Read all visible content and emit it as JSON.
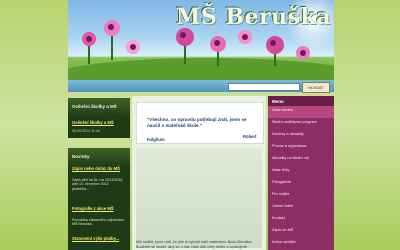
{
  "header": {
    "title": "MŠ Beruška"
  },
  "search": {
    "placeholder": "",
    "button": "HLEDAT"
  },
  "left": {
    "box1": {
      "title": "Ocěnění školky a MŠ",
      "link": "Ocěnění školky a MŠ",
      "date": "06.09.2014 11:44"
    },
    "box2": {
      "title": "Novinky",
      "news": [
        {
          "link": "Zápis nebo dotaz do MŠ",
          "text": "Zápis dětí na šk. rok 2014/2015, dne 14. července 2012 proběhla..."
        },
        {
          "link": "Fotografie z akce MŠ",
          "text": "Pozvánka zábavného odpoledne MŠ Beruška"
        },
        {
          "link": "Stanovení výše platby...",
          "text": ""
        }
      ]
    }
  },
  "content": {
    "quote": "\"Všechno, co opravdu potřebuji znát, jsem se naučil v mateřské škole.\"",
    "author": "Robert",
    "author2": "Fulghum",
    "para": "Milí rodiče, jsme rádi, že jste si vybrali naši mateřskou školu Beruška. Budeme se snažit, aby se u nás vaše děti cítily dobře a spokojeně."
  },
  "menu": {
    "title": "Menu",
    "items": [
      "Naše školka",
      "Školní vzdělávací program",
      "Novinky a aktuality",
      "Provoz a organizace",
      "Aktuality na školní rok",
      "Naše třídy",
      "Fotogalerie",
      "Pro rodiče",
      "Jídelní lístek",
      "Kontakt",
      "Zápis do MŠ",
      "Kniha návštěv"
    ]
  }
}
